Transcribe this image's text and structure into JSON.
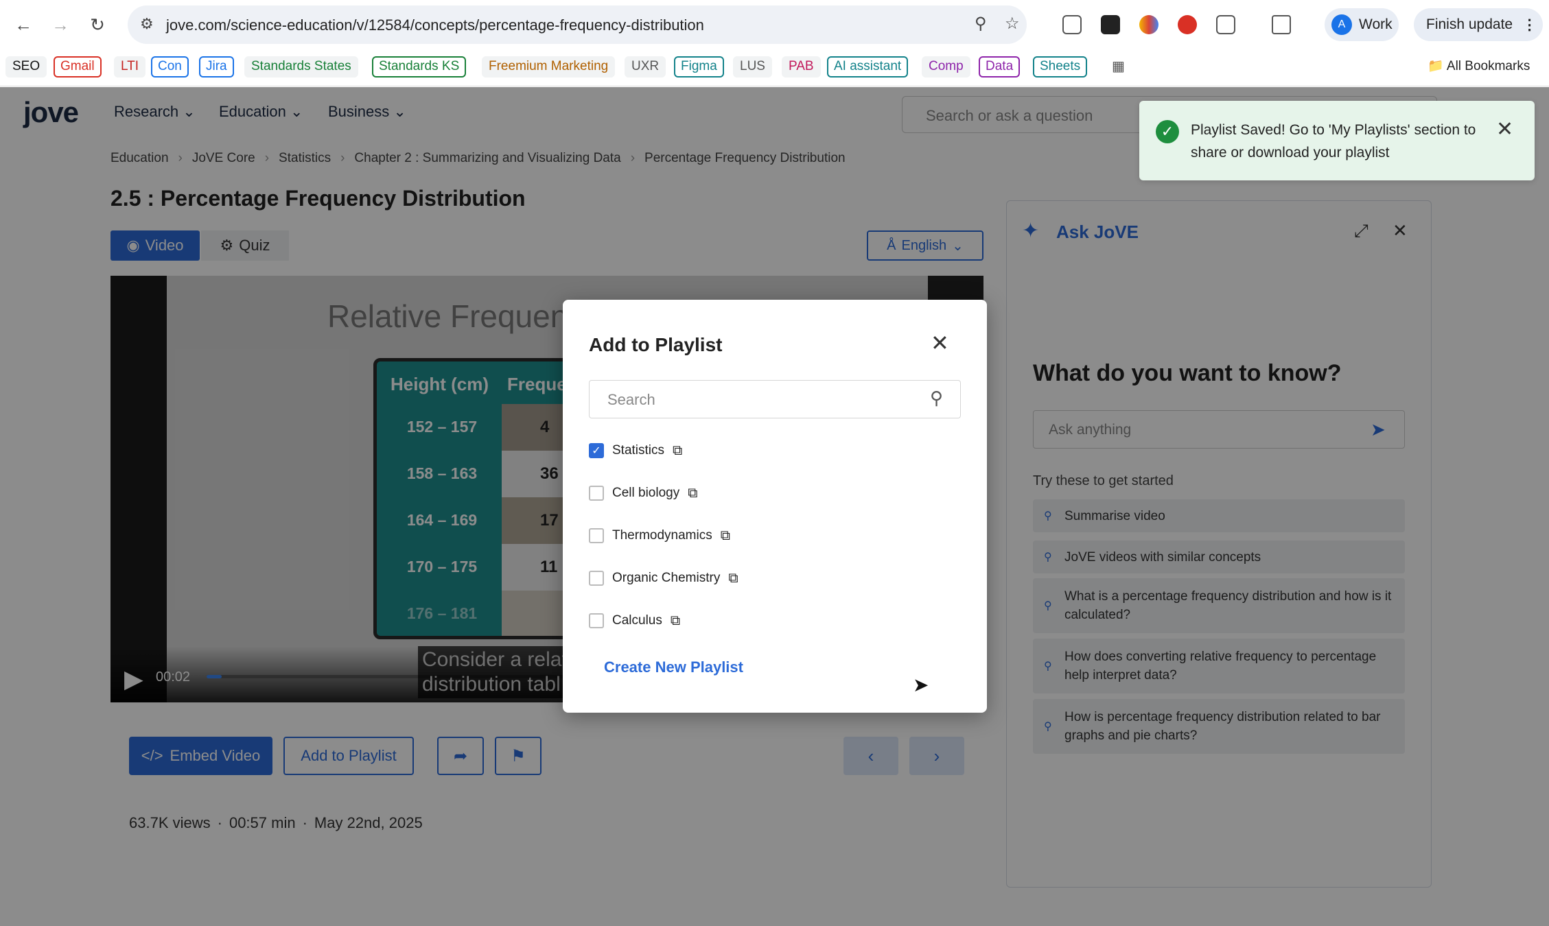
{
  "browser": {
    "url": "jove.com/science-education/v/12584/concepts/percentage-frequency-distribution",
    "profile_label": "Work",
    "profile_initial": "A",
    "update_label": "Finish update",
    "all_bookmarks_label": "All Bookmarks",
    "bookmarks": [
      {
        "label": "SEO",
        "color": "#111111",
        "outlined": false
      },
      {
        "label": "Gmail",
        "color": "#d93025",
        "outlined": true
      },
      {
        "label": "LTI",
        "color": "#c5221f",
        "outlined": false
      },
      {
        "label": "Con",
        "color": "#1a73e8",
        "outlined": true
      },
      {
        "label": "Jira",
        "color": "#1a73e8",
        "outlined": true
      },
      {
        "label": "Standards States",
        "color": "#188038",
        "outlined": false
      },
      {
        "label": "Standards KS",
        "color": "#188038",
        "outlined": true
      },
      {
        "label": "Freemium Marketing",
        "color": "#b06000",
        "outlined": false
      },
      {
        "label": "UXR",
        "color": "#555555",
        "outlined": false
      },
      {
        "label": "Figma",
        "color": "#12828a",
        "outlined": true
      },
      {
        "label": "LUS",
        "color": "#555555",
        "outlined": false
      },
      {
        "label": "PAB",
        "color": "#c2185b",
        "outlined": false
      },
      {
        "label": "AI assistant",
        "color": "#12828a",
        "outlined": true
      },
      {
        "label": "Comp",
        "color": "#8e24aa",
        "outlined": false
      },
      {
        "label": "Data",
        "color": "#8e24aa",
        "outlined": true
      },
      {
        "label": "Sheets",
        "color": "#12828a",
        "outlined": true
      }
    ]
  },
  "site": {
    "logo": "jove",
    "nav": [
      "Research",
      "Education",
      "Business"
    ],
    "search_placeholder": "Search or ask a question"
  },
  "breadcrumbs": [
    "Education",
    "JoVE Core",
    "Statistics",
    "Chapter 2 : Summarizing and Visualizing Data",
    "Percentage Frequency Distribution"
  ],
  "page_title": "2.5 : Percentage Frequency Distribution",
  "tabs": {
    "video": "Video",
    "quiz": "Quiz"
  },
  "language": "English",
  "video": {
    "slide_title": "Relative Frequen",
    "col_height": "Height (cm)",
    "col_freq": "Freque",
    "rows": [
      {
        "height": "152 – 157",
        "freq": "4"
      },
      {
        "height": "158 – 163",
        "freq": "36"
      },
      {
        "height": "164 – 169",
        "freq": "17"
      },
      {
        "height": "170 – 175",
        "freq": "11"
      },
      {
        "height": "176 – 181",
        "freq": ""
      }
    ],
    "time": "00:02",
    "progress_pct": 2,
    "caption_line1": "Consider a relat",
    "caption_line2": "distribution tabl"
  },
  "actions": {
    "embed": "Embed Video",
    "add_playlist": "Add to Playlist"
  },
  "meta": {
    "views": "63.7K views",
    "duration": "00:57 min",
    "date": "May 22nd, 2025",
    "separator": "·"
  },
  "ask": {
    "title": "Ask JoVE",
    "heading": "What do you want to know?",
    "placeholder": "Ask anything",
    "try_label": "Try these to get started",
    "suggestions": [
      "Summarise video",
      "JoVE videos with similar concepts",
      "What is a percentage frequency distribution and how is it calculated?",
      "How does converting relative frequency to percentage help interpret data?",
      "How is percentage frequency distribution related to bar graphs and pie charts?"
    ]
  },
  "toast": {
    "message": "Playlist Saved! Go to 'My Playlists' section to share or download your playlist"
  },
  "modal": {
    "title": "Add to Playlist",
    "search_placeholder": "Search",
    "playlists": [
      {
        "name": "Statistics",
        "checked": true
      },
      {
        "name": "Cell biology",
        "checked": false
      },
      {
        "name": "Thermodynamics",
        "checked": false
      },
      {
        "name": "Organic Chemistry",
        "checked": false
      },
      {
        "name": "Calculus",
        "checked": false
      }
    ],
    "create_label": "Create New Playlist"
  }
}
